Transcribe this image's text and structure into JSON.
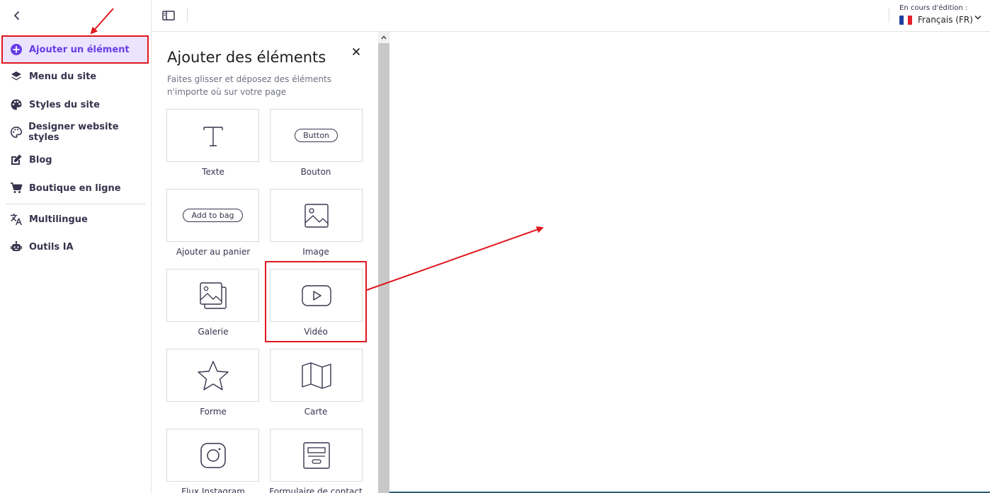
{
  "sidebar": {
    "items": [
      {
        "label": "Ajouter un élément",
        "icon": "plus-circle-icon"
      },
      {
        "label": "Menu du site",
        "icon": "layers-icon"
      },
      {
        "label": "Styles du site",
        "icon": "palette-icon"
      },
      {
        "label": "Designer website styles",
        "icon": "palette-outline-icon"
      },
      {
        "label": "Blog",
        "icon": "edit-note-icon"
      },
      {
        "label": "Boutique en ligne",
        "icon": "cart-icon"
      },
      {
        "label": "Multilingue",
        "icon": "translate-icon"
      },
      {
        "label": "Outils IA",
        "icon": "robot-icon"
      }
    ]
  },
  "topbar": {
    "editing_caption": "En cours d'édition :",
    "language": "Français (FR)"
  },
  "panel": {
    "title": "Ajouter des éléments",
    "description": "Faites glisser et déposez des éléments n'importe où sur votre page",
    "tiles": [
      {
        "label": "Texte",
        "icon": "text-icon"
      },
      {
        "label": "Bouton",
        "icon": "button-icon",
        "pill": "Button"
      },
      {
        "label": "Ajouter au panier",
        "icon": "add-to-bag-icon",
        "pill": "Add to bag"
      },
      {
        "label": "Image",
        "icon": "image-icon"
      },
      {
        "label": "Galerie",
        "icon": "gallery-icon"
      },
      {
        "label": "Vidéo",
        "icon": "video-icon"
      },
      {
        "label": "Forme",
        "icon": "star-icon"
      },
      {
        "label": "Carte",
        "icon": "map-icon"
      },
      {
        "label": "Flux Instagram",
        "icon": "instagram-icon"
      },
      {
        "label": "Formulaire de contact",
        "icon": "form-icon"
      }
    ]
  },
  "colors": {
    "accent": "#673de6",
    "active_bg": "#ebe4ff",
    "annotation": "#e0171e",
    "scroll_track": "#c8c8c8"
  }
}
